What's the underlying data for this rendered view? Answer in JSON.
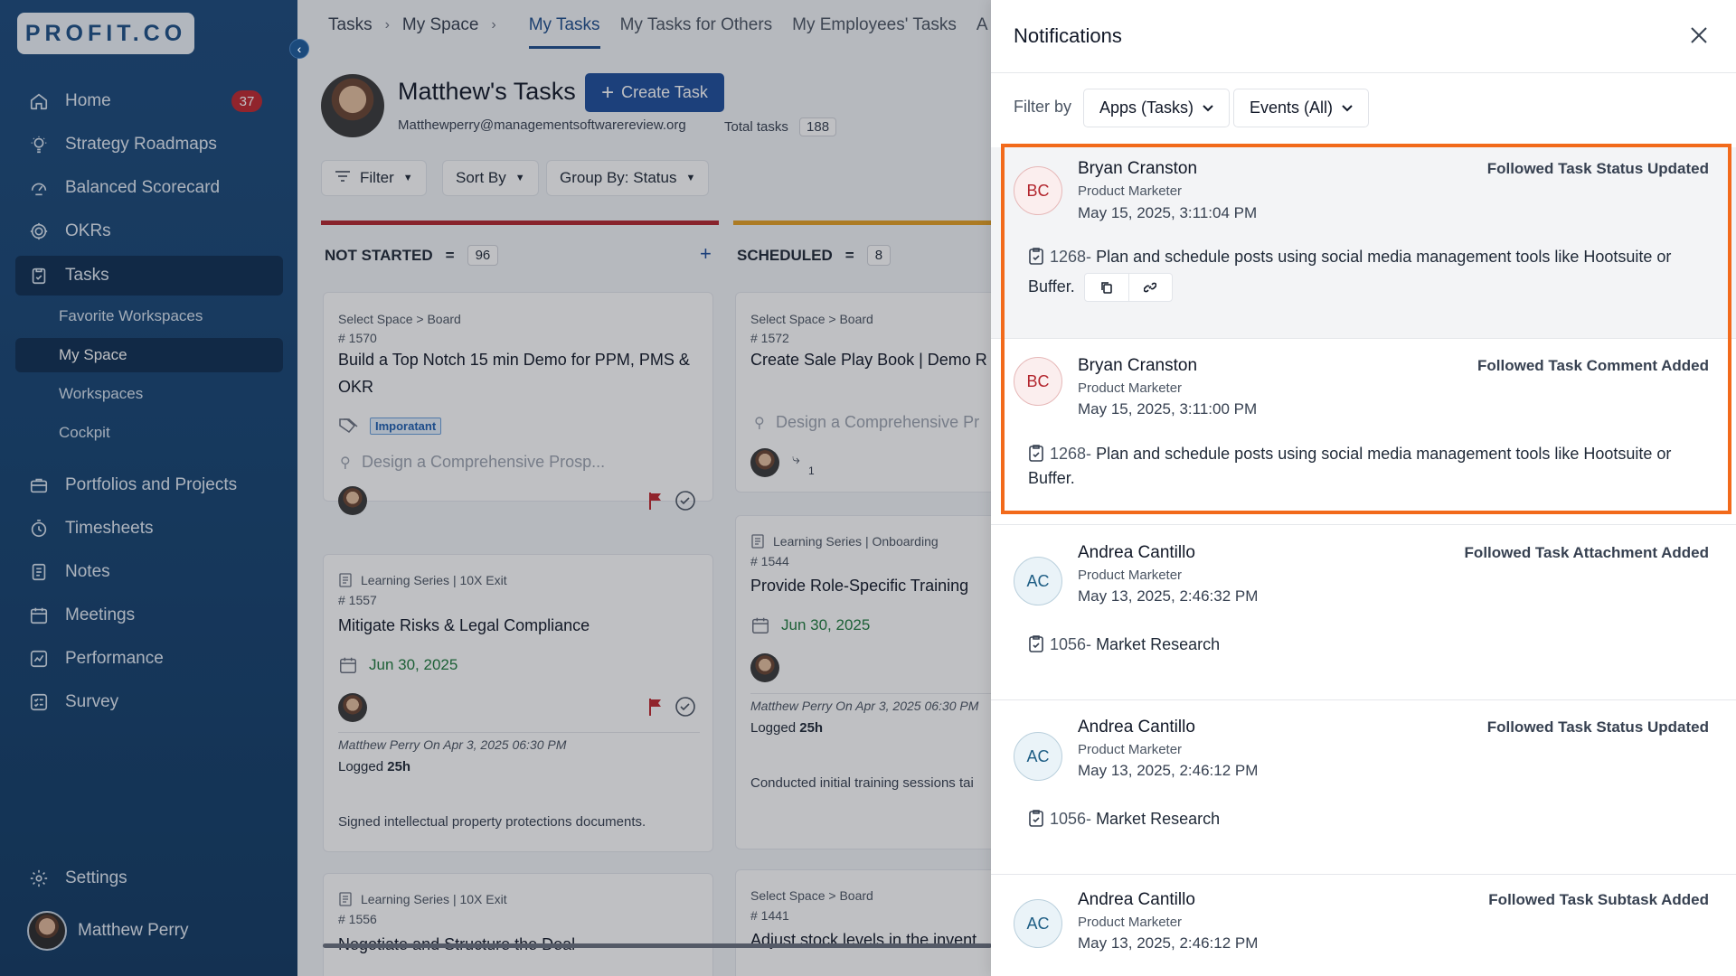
{
  "sidebar": {
    "logo": "PROFIT.CO",
    "nav": [
      {
        "label": "Home",
        "icon": "home-icon",
        "badge": "37"
      },
      {
        "label": "Strategy Roadmaps",
        "icon": "lightbulb-icon"
      },
      {
        "label": "Balanced Scorecard",
        "icon": "scorecard-icon"
      },
      {
        "label": "OKRs",
        "icon": "target-icon"
      },
      {
        "label": "Tasks",
        "icon": "clipboard-icon"
      }
    ],
    "sub": [
      "Favorite Workspaces",
      "My Space",
      "Workspaces",
      "Cockpit"
    ],
    "nav2": [
      {
        "label": "Portfolios and Projects",
        "icon": "briefcase-icon"
      },
      {
        "label": "Timesheets",
        "icon": "stopwatch-icon"
      },
      {
        "label": "Notes",
        "icon": "notes-icon"
      },
      {
        "label": "Meetings",
        "icon": "calendar-icon"
      },
      {
        "label": "Performance",
        "icon": "chart-icon"
      },
      {
        "label": "Survey",
        "icon": "survey-icon"
      }
    ],
    "settings": "Settings",
    "user": "Matthew Perry"
  },
  "topbar": {
    "crumbs": [
      "Tasks",
      "My Space"
    ],
    "tabs": [
      "My Tasks",
      "My Tasks for Others",
      "My Employees' Tasks",
      "A"
    ]
  },
  "header": {
    "title": "Matthew's Tasks",
    "create": "Create Task",
    "email": "Matthewperry@managementsoftwarereview.org",
    "total_label": "Total tasks",
    "total": "188"
  },
  "controls": {
    "filter": "Filter",
    "sort": "Sort By",
    "group": "Group By: Status"
  },
  "columns": [
    {
      "name": "NOT STARTED",
      "count": "96",
      "color": "#b3262e"
    },
    {
      "name": "SCHEDULED",
      "count": "8",
      "color": "#e5a023"
    }
  ],
  "cards": {
    "c1": {
      "path": "Select Space > Board",
      "num": "# 1570",
      "title": "Build a Top Notch 15 min Demo for PPM, PMS & OKR",
      "tag": "Imporatant",
      "ghost": "Design a Comprehensive Prosp..."
    },
    "c2": {
      "path": "Learning Series | 10X Exit",
      "num": "# 1557",
      "title": "Mitigate Risks & Legal Compliance",
      "date": "Jun 30, 2025",
      "log": "Matthew Perry On Apr 3, 2025 06:30 PM",
      "logged_label": "Logged",
      "logged": "25h",
      "desc": "Signed intellectual property protections documents."
    },
    "c3": {
      "path": "Learning Series | 10X Exit",
      "num": "# 1556",
      "title": "Negotiate and Structure the Deal"
    },
    "s1": {
      "path": "Select Space > Board",
      "num": "# 1572",
      "title": "Create Sale Play Book | Demo R",
      "ghost": "Design a Comprehensive Pr",
      "sub": "1"
    },
    "s2": {
      "path": "Learning Series | Onboarding",
      "num": "# 1544",
      "title": "Provide Role-Specific Training",
      "date": "Jun 30, 2025",
      "log": "Matthew Perry On Apr 3, 2025 06:30 PM",
      "logged_label": "Logged",
      "logged": "25h",
      "desc": "Conducted initial training sessions tai"
    },
    "s3": {
      "path": "Select Space > Board",
      "num": "# 1441",
      "title": "Adjust stock levels in the invent"
    }
  },
  "notifications": {
    "title": "Notifications",
    "filter_label": "Filter by",
    "apps": "Apps (Tasks)",
    "events": "Events (All)",
    "items": [
      {
        "initials": "BC",
        "name": "Bryan Cranston",
        "role": "Product Marketer",
        "time": "May 15, 2025, 3:11:04 PM",
        "event": "Followed Task Status Updated",
        "task_id": "1268-",
        "task": "Plan and schedule posts using social media management tools like Hootsuite or Buffer."
      },
      {
        "initials": "BC",
        "name": "Bryan Cranston",
        "role": "Product Marketer",
        "time": "May 15, 2025, 3:11:00 PM",
        "event": "Followed Task Comment Added",
        "task_id": "1268-",
        "task": "Plan and schedule posts using social media management tools like Hootsuite or Buffer."
      },
      {
        "initials": "AC",
        "name": "Andrea Cantillo",
        "role": "Product Marketer",
        "time": "May 13, 2025, 2:46:32 PM",
        "event": "Followed Task Attachment Added",
        "task_id": "1056-",
        "task": "Market Research"
      },
      {
        "initials": "AC",
        "name": "Andrea Cantillo",
        "role": "Product Marketer",
        "time": "May 13, 2025, 2:46:12 PM",
        "event": "Followed Task Status Updated",
        "task_id": "1056-",
        "task": "Market Research"
      },
      {
        "initials": "AC",
        "name": "Andrea Cantillo",
        "role": "Product Marketer",
        "time": "May 13, 2025, 2:46:12 PM",
        "event": "Followed Task Subtask Added"
      }
    ]
  }
}
